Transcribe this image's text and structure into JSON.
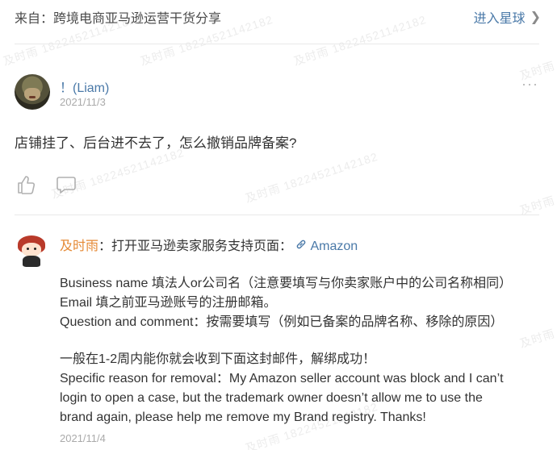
{
  "watermark": "及时雨 18224521142182",
  "source": {
    "label": "来自：跨境电商亚马逊运营干货分享",
    "join_label": "进入星球"
  },
  "post": {
    "author": "！(Liam)",
    "date": "2021/11/3",
    "more": "···",
    "body": "店铺挂了、后台进不去了，怎么撤销品牌备案?"
  },
  "comment": {
    "author": "及时雨",
    "intro": "：打开亚马逊卖家服务支持页面：",
    "link_label": "Amazon",
    "lines": [
      "Business name 填法人or公司名（注意要填写与你卖家账户中的公司名称相同）",
      "Email 填之前亚马逊账号的注册邮箱。",
      "Question and comment：按需要填写（例如已备案的品牌名称、移除的原因）",
      "",
      "一般在1-2周内能你就会收到下面这封邮件，解绑成功！",
      "Specific reason for removal：My Amazon seller account was block and I can’t",
      "login to open a case, but the trademark owner doesn’t allow me to use the",
      "brand again, please help me remove my Brand registry. Thanks!"
    ],
    "date": "2021/11/4"
  },
  "icons": {
    "like": "thumbs-up-icon",
    "comment": "comment-bubble-icon",
    "more": "more-dots-icon",
    "chevron": "chevron-right-icon",
    "link": "link-icon"
  },
  "colors": {
    "link": "#4a79a8",
    "comment_author": "#e58a36",
    "muted": "#aaaaaa",
    "text": "#333333"
  }
}
